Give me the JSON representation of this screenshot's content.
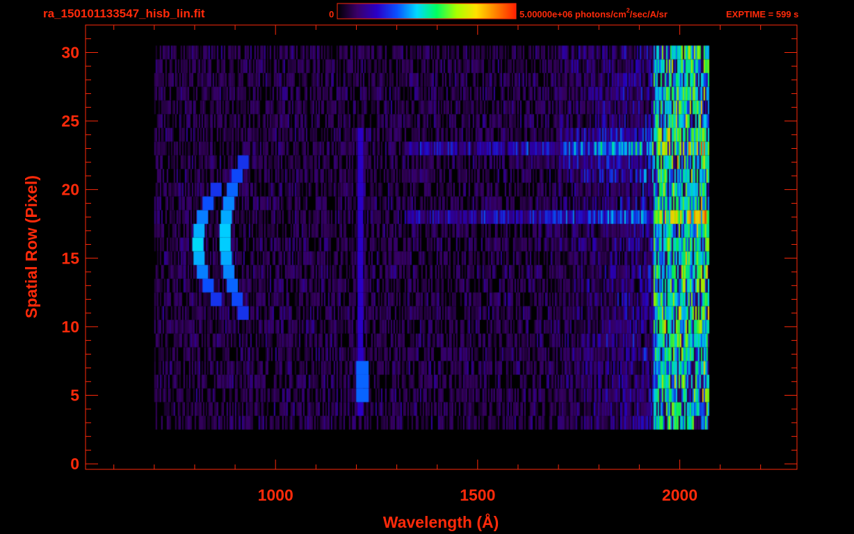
{
  "header": {
    "filename": "ra_150101133547_hisb_lin.fit",
    "colorbar_min": "0",
    "colorbar_max_prefix": "5.00000e+06 photons/cm",
    "colorbar_max_sup": "2",
    "colorbar_max_suffix": "/sec/A/sr",
    "exptime": "EXPTIME = 599 s"
  },
  "colors": {
    "axis": "#ff2a0a",
    "background": "#000000",
    "colormap": [
      "#000000",
      "#3a0068",
      "#2a00c8",
      "#0a50ff",
      "#00d8ff",
      "#00ff60",
      "#a8ff00",
      "#ffe000",
      "#ff8000",
      "#ff2000"
    ]
  },
  "chart_data": {
    "type": "heatmap",
    "xlabel": "Wavelength (Å)",
    "ylabel": "Spatial Row (Pixel)",
    "xlim": [
      530,
      2290
    ],
    "ylim": [
      -0.4,
      32.0
    ],
    "xticks": [
      1000,
      1500,
      2000
    ],
    "yticks": [
      0,
      5,
      10,
      15,
      20,
      25,
      30
    ],
    "x_minor_step": 100,
    "y_minor_step": 1,
    "rows": 28,
    "row_range": [
      3,
      30
    ],
    "wavelength_range": [
      700,
      2070
    ],
    "colorbar_range": [
      0,
      5000000
    ],
    "features": [
      {
        "wavelength": 875,
        "rows": [
          11,
          22
        ],
        "peak_intensity": 0.45,
        "note": "arc"
      },
      {
        "wavelength": 808,
        "rows": [
          12,
          20
        ],
        "peak_intensity": 0.45,
        "note": "arc"
      },
      {
        "wavelength": 1210,
        "rows": [
          4,
          24
        ],
        "peak_intensity": 0.22,
        "note": "vertical line"
      },
      {
        "wavelength": 1215,
        "rows": [
          5,
          7
        ],
        "peak_intensity": 0.35,
        "note": "bright spot"
      }
    ]
  }
}
